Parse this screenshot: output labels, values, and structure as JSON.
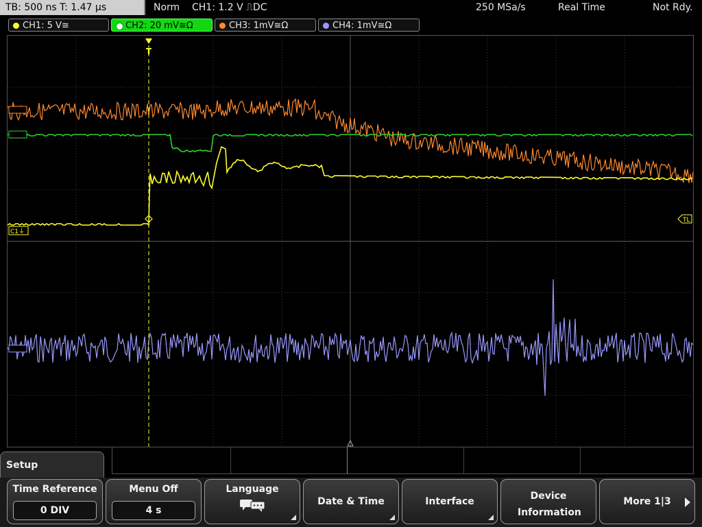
{
  "status": {
    "timebase": "TB: 500 ns   T: 1.47 μs",
    "mode": "Norm",
    "trigger": "CH1: 1.2 V ⎍DC",
    "samplerate": "250 MSa/s",
    "acq": "Real Time",
    "state": "Not Rdy."
  },
  "channels": [
    {
      "label": "CH1: 5 V≅",
      "color": "#ffff30"
    },
    {
      "label": "CH2: 20 mV≅Ω",
      "color": "#2ad82a",
      "active": true
    },
    {
      "label": "CH3: 1mV≅Ω",
      "color": "#ff8a30"
    },
    {
      "label": "CH4: 1mV≅Ω",
      "color": "#9a9aff"
    }
  ],
  "markers": {
    "c1": "C1⏚",
    "tl": "TL",
    "t": "T"
  },
  "menu": {
    "title": "Setup",
    "softkeys": [
      {
        "label": "Time Reference",
        "value": "0 DIV"
      },
      {
        "label": "Menu Off",
        "value": "4 s"
      },
      {
        "label": "Language",
        "icon": "speech-bubble-icon"
      },
      {
        "label": "Date & Time"
      },
      {
        "label": "Interface"
      },
      {
        "label": "Device Information"
      },
      {
        "label": "More 1|3"
      }
    ]
  },
  "colors": {
    "ch1": "#ffff30",
    "ch2": "#2ad82a",
    "ch3": "#ff8a30",
    "ch4": "#9a9aff",
    "grid": "#404040"
  }
}
